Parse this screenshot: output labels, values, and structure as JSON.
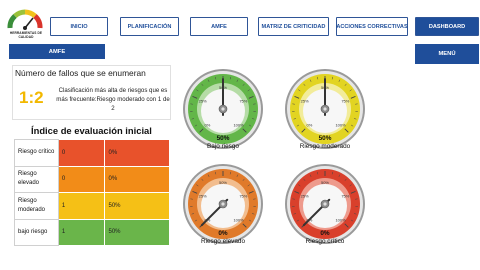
{
  "logo": {
    "caption": "HERRAMIENTAS DE CALIDAD"
  },
  "nav": {
    "inicio": "INICIO",
    "planificacion": "PLANIFICACIÓN",
    "amfe": "AMFE",
    "matriz": "MATRIZ DE CRITICIDAD",
    "acciones": "ACCIONES CORRECTIVAS",
    "dashboard": "DASHBOARD"
  },
  "amfe_tab": "AMFE",
  "menu_label": "MENÚ",
  "failures": {
    "title": "Número de fallos que se enumeran",
    "value": "1:2",
    "description": "Clasificación más alta de riesgos que es más frecuente:Riesgo moderado con 1 de 2"
  },
  "evaluation": {
    "title": "Índice de evaluación inicial",
    "rows": [
      {
        "label": "Riesgo crítico",
        "count": "0",
        "percent": "0%",
        "color": "#e8522b"
      },
      {
        "label": "Riesgo elevado",
        "count": "0",
        "percent": "0%",
        "color": "#f28c18"
      },
      {
        "label": "Riesgo moderado",
        "count": "1",
        "percent": "50%",
        "color": "#f5c016"
      },
      {
        "label": "bajo riesgo",
        "count": "1",
        "percent": "50%",
        "color": "#6ab54a"
      }
    ]
  },
  "gauges": [
    {
      "id": "bajo",
      "percent_label": "50%",
      "label": "Bajo riesgo",
      "value": 0.5,
      "color": "#63b649",
      "light": "#b5dca6"
    },
    {
      "id": "moderado",
      "percent_label": "50%",
      "label": "Riesgo moderado",
      "value": 0.5,
      "color": "#e2d422",
      "light": "#f2ec9a"
    },
    {
      "id": "elevado",
      "percent_label": "0%",
      "label": "Riesgo elevado",
      "value": 0.0,
      "color": "#e07a2a",
      "light": "#f2bd8e"
    },
    {
      "id": "critico",
      "percent_label": "0%",
      "label": "Riesgo crítico",
      "value": 0.0,
      "color": "#d9402c",
      "light": "#ee9a8c"
    }
  ],
  "gauge_ticks": [
    "0%",
    "25%",
    "50%",
    "75%",
    "100%"
  ]
}
